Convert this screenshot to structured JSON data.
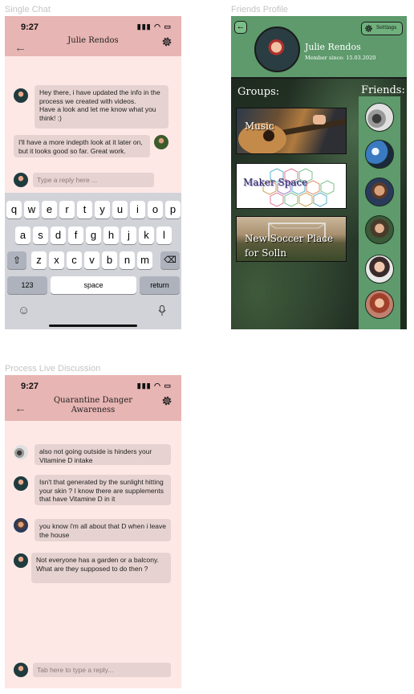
{
  "labels": {
    "single_chat": "Single Chat",
    "friends_profile": "Friends Profile",
    "process_live": "Process Live Discussion"
  },
  "single_chat": {
    "time": "9:27",
    "title": "Julie Rendos",
    "messages": [
      {
        "text": "Hey there, i have updated the info in the process we created with videos.\nHave a look and let me know what you think! :)",
        "side": "left"
      },
      {
        "text": "I'll have a more indepth look at it later on, but it looks good so far. Great work.",
        "side": "right"
      }
    ],
    "reply_placeholder": "Type a reply here ...",
    "keyboard": {
      "row1": [
        "q",
        "w",
        "e",
        "r",
        "t",
        "y",
        "u",
        "i",
        "o",
        "p"
      ],
      "row2": [
        "a",
        "s",
        "d",
        "f",
        "g",
        "h",
        "j",
        "k",
        "l"
      ],
      "row3": [
        "z",
        "x",
        "c",
        "v",
        "b",
        "n",
        "m"
      ],
      "numbers_label": "123",
      "space_label": "space",
      "return_label": "return"
    }
  },
  "friends_profile": {
    "name": "Julie Rendos",
    "member_since": "Member since: 15.03.2020",
    "settings_label": "Settings",
    "groups_title": "Groups:",
    "friends_title": "Friends:",
    "groups": [
      "Music",
      "Maker Space",
      "New Soccer Place for Solln"
    ]
  },
  "process_live": {
    "time": "9:27",
    "title": "Quarantine Danger Awareness",
    "messages": [
      "also not going outside is hinders your Vitamine D intake",
      "Isn't that generated by the sunlight hitting your skin ? I know there are supplements that have Vitamine D in it",
      "you know i'm all about that D when i leave the house",
      "Not everyone has a garden or a balcony. What are they supposed to do then ?"
    ],
    "reply_placeholder": "Tab here to type a reply..."
  },
  "colors": {
    "header_pink": "#e7b5b3",
    "chat_bg": "#fde8e6",
    "bubble": "#e6d3d1",
    "profile_green": "#5e9a6c"
  }
}
